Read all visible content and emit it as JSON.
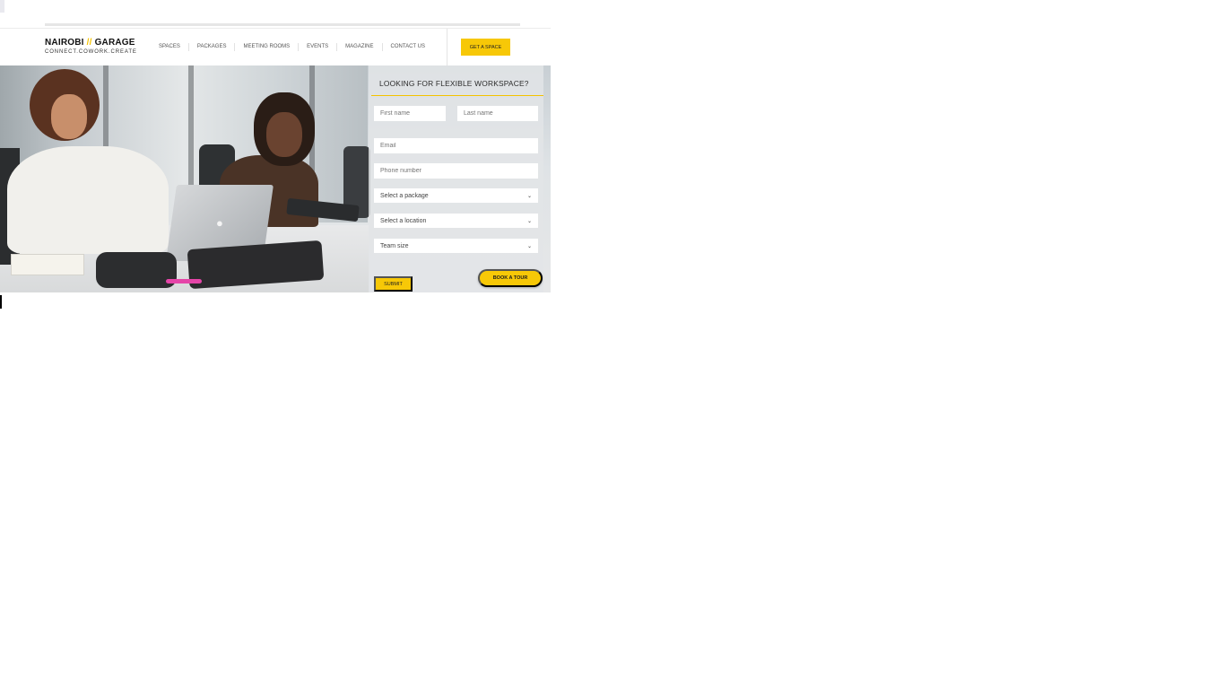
{
  "site": {
    "logo_name": "NAIROBI",
    "logo_sep": "//",
    "logo_name2": "GARAGE",
    "logo_tagline": "CONNECT.COWORK.CREATE"
  },
  "nav": {
    "items": [
      {
        "label": "SPACES"
      },
      {
        "label": "PACKAGES"
      },
      {
        "label": "MEETING ROOMS"
      },
      {
        "label": "EVENTS"
      },
      {
        "label": "MAGAZINE"
      },
      {
        "label": "CONTACT US"
      }
    ],
    "cta_label": "GET A SPACE"
  },
  "form": {
    "title": "LOOKING FOR FLEXIBLE WORKSPACE?",
    "first_name_placeholder": "First name",
    "last_name_placeholder": "Last name",
    "email_placeholder": "Email",
    "phone_placeholder": "Phone number",
    "package_select": "Select a package",
    "location_select": "Select a location",
    "team_size_select": "Team size",
    "submit_label": "SUBMIT"
  },
  "book_tour_label": "BOOK A TOUR",
  "colors": {
    "accent": "#f7c807",
    "text": "#111111"
  }
}
